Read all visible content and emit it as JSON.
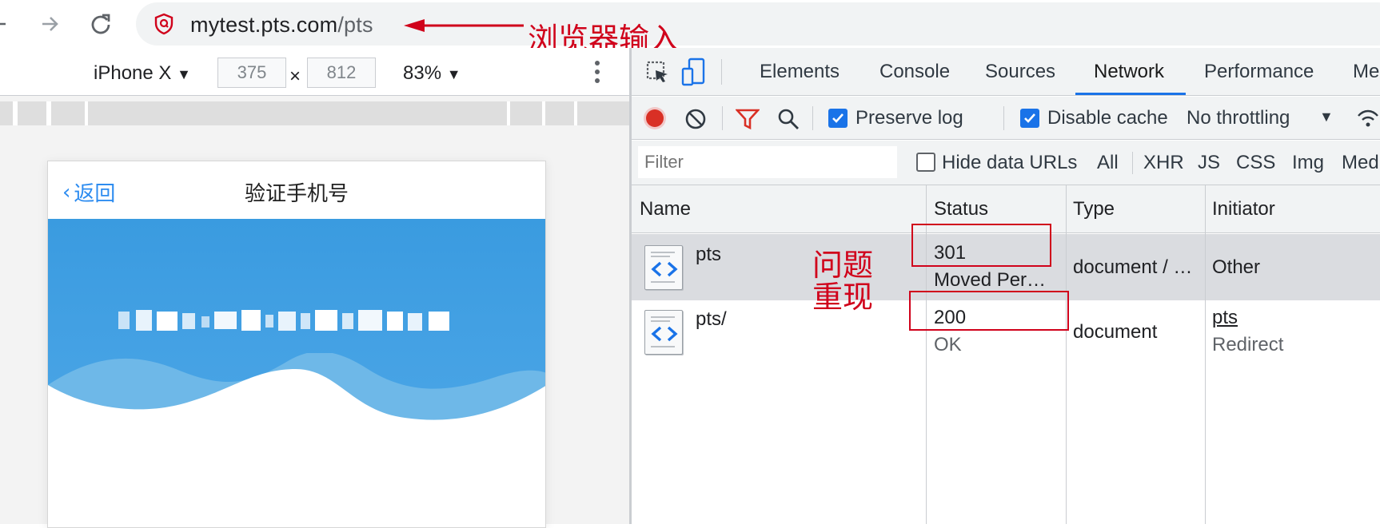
{
  "browser": {
    "url_host": "mytest.pts.com",
    "url_path": "/pts",
    "annotation": "浏览器输入"
  },
  "device_toolbar": {
    "device": "iPhone X",
    "width": "375",
    "times": "×",
    "height": "812",
    "zoom": "83%"
  },
  "phone": {
    "back_label": "返回",
    "title": "验证手机号"
  },
  "devtools": {
    "tabs": [
      "Elements",
      "Console",
      "Sources",
      "Network",
      "Performance",
      "Me"
    ],
    "active_tab": "Network",
    "toolbar": {
      "preserve_log": "Preserve log",
      "disable_cache": "Disable cache",
      "throttling": "No throttling"
    },
    "filterbar": {
      "filter_placeholder": "Filter",
      "hide_data_urls": "Hide data URLs",
      "types": [
        "All",
        "XHR",
        "JS",
        "CSS",
        "Img",
        "Medi"
      ]
    },
    "table": {
      "columns": [
        "Name",
        "Status",
        "Type",
        "Initiator"
      ],
      "rows": [
        {
          "name": "pts",
          "status": "301",
          "status_text": "Moved Per…",
          "type": "document / …",
          "initiator": "Other",
          "initiator_sub": ""
        },
        {
          "name": "pts/",
          "status": "200",
          "status_text": "OK",
          "type": "document",
          "initiator": "pts",
          "initiator_sub": "Redirect"
        }
      ]
    },
    "annotation_line1": "问题",
    "annotation_line2": "重现"
  },
  "colors": {
    "annotation_red": "#d0021b",
    "accent_blue": "#1a73e8",
    "banner_blue": "#3a9be0"
  }
}
